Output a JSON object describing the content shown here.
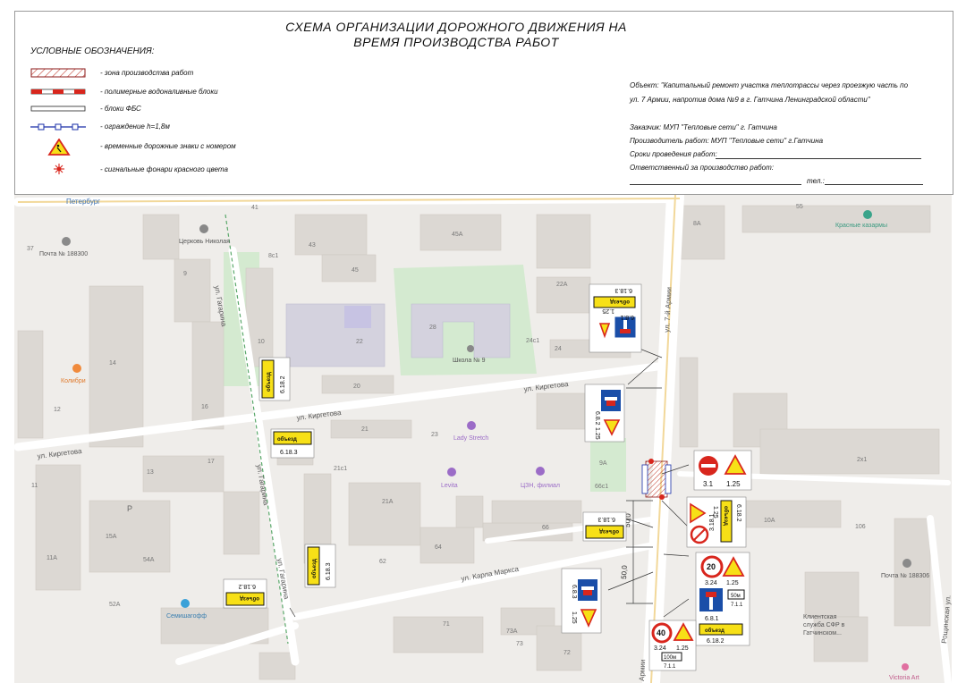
{
  "header": {
    "title_line1": "СХЕМА ОРГАНИЗАЦИИ ДОРОЖНОГО ДВИЖЕНИЯ НА",
    "title_line2": "ВРЕМЯ ПРОИЗВОДСТВА РАБОТ"
  },
  "legend": {
    "heading": "УСЛОВНЫЕ ОБОЗНАЧЕНИЯ:",
    "items": [
      {
        "text": "- зона производства работ",
        "symbol": "hatched-zone"
      },
      {
        "text": "- полимерные водоналивные блоки",
        "symbol": "red-white-blocks"
      },
      {
        "text": "- блоки ФБС",
        "symbol": "fbs-block"
      },
      {
        "text": "- ограждение h=1,8м",
        "symbol": "fence"
      },
      {
        "text": "- временные дорожные знаки с номером",
        "symbol": "roadworks-sign"
      },
      {
        "text": "- сигнальные фонари красного цвета",
        "symbol": "red-lamp"
      }
    ]
  },
  "info": {
    "object_line1": "Объект: \"Капитальный ремонт участка теплотрассы через проезжую часть по",
    "object_line2": "ул. 7 Армии, напротив дома №9 в г. Гатчина Ленинградской области\"",
    "customer": "Заказчик:  МУП \"Тепловые сети\" г. Гатчина",
    "contractor": "Производитель работ: МУП \"Тепловые сети\" г.Гатчина",
    "dates": "Сроки проведения работ:",
    "responsible": "Ответственный за производство работ:",
    "phone": "тел.:"
  },
  "map": {
    "colors": {
      "background": "#efedea",
      "road": "#ffffff",
      "building": "#dedad6",
      "park": "#cfe8c9",
      "school": "#d6d4dd",
      "sign_yellow": "#f7e017",
      "sign_blue": "#1a4ea8",
      "sign_red": "#d8261d"
    },
    "streets": {
      "seventh_army": "ул. 7-й Армии",
      "seventh_army_bottom": "Армии",
      "kirgetova_1": "ул. Киргетова",
      "kirgetova_2": "ул. Киргетова",
      "kirgetova_3": "ул. Киргетова",
      "gagarina_1": "ул. Гагарина",
      "gagarina_2": "ул. Гагарина",
      "gagarina_3": "ул. Гагарина",
      "karla_marksa": "ул. Карла Маркса",
      "roshchinskaya": "Рощинская ул.",
      "peterburg": "Петербург"
    },
    "pois": {
      "church": "Церковь Николая",
      "post1": "Почта № 188300",
      "post2": "Почта № 188306",
      "school": "Школа № 9",
      "kolibri": "Колибри",
      "lady_stretch": "Lady Stretch",
      "levita": "Levita",
      "czn": "ЦЗН, филиал",
      "semishagoff": "Семишагофф",
      "sfr_1": "Клиентская",
      "sfr_2": "служба СФР в",
      "sfr_3": "Гатчинском...",
      "krasnye_kazarmy": "Красные казармы",
      "victoria": "Victoria Art",
      "p": "P"
    },
    "house_numbers": [
      "41",
      "43",
      "45",
      "45А",
      "8с1",
      "37",
      "9",
      "10",
      "14",
      "16",
      "12",
      "17",
      "13",
      "15А",
      "54А",
      "11",
      "11А",
      "52А",
      "22",
      "28",
      "24с1",
      "24",
      "20",
      "21",
      "23",
      "21с1",
      "21А",
      "66с1",
      "9А",
      "66",
      "64",
      "62",
      "18",
      "71",
      "73А",
      "73",
      "72",
      "8А",
      "55",
      "22А",
      "2х1",
      "10А",
      "106"
    ],
    "signs": {
      "obezd": "объезд",
      "s_6_18_2": "6.18.2",
      "s_6_18_3": "6.18.3",
      "s_6_8_1": "6.8.1",
      "s_6_8_2": "6.8.2",
      "s_6_8_3": "6.8.3",
      "s_1_25": "1.25",
      "s_3_1": "3.1",
      "s_3_18_1": "3.18.1",
      "s_3_24": "3.24",
      "s_7_1_1": "7.1.1",
      "speed_20": "20",
      "speed_40": "40",
      "dist_50m": "50м",
      "dist_100m": "100м",
      "dim_50": "50,0"
    }
  }
}
